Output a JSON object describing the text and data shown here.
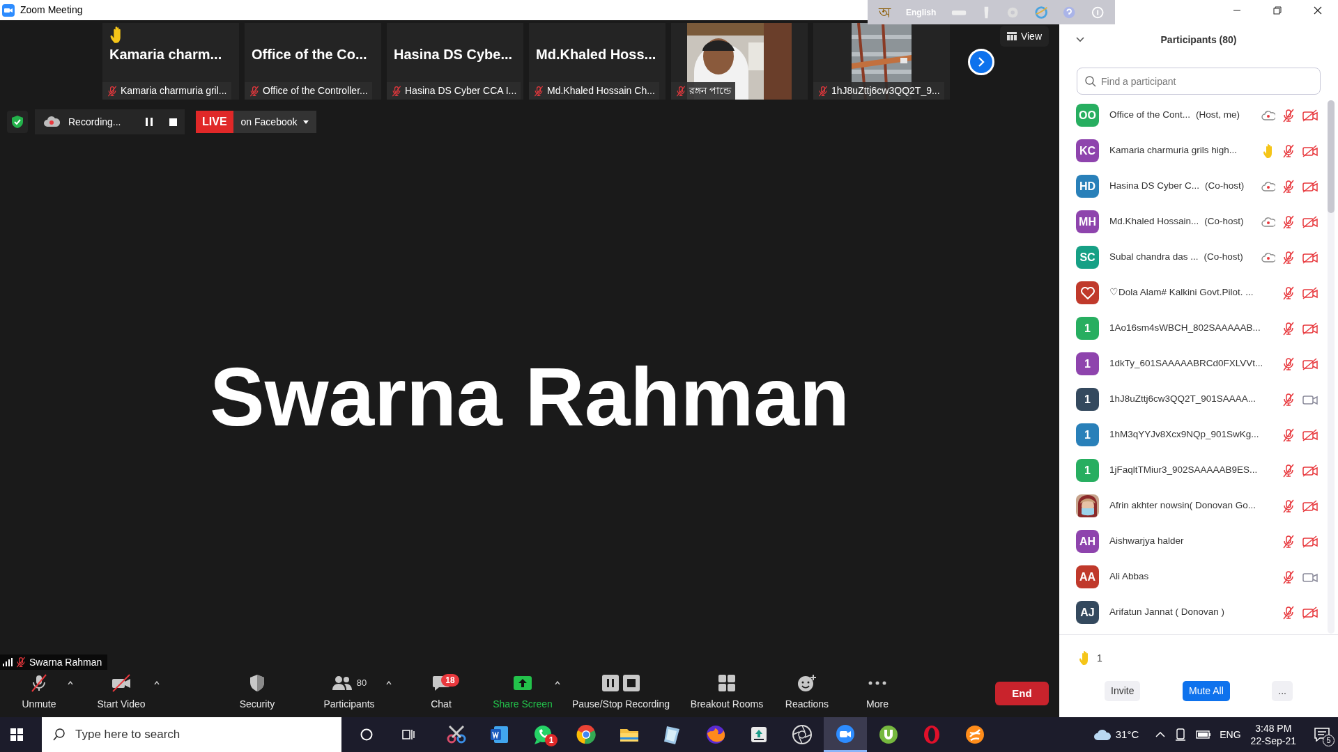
{
  "window": {
    "title": "Zoom Meeting"
  },
  "ime_bar": {
    "script_glyph": "অ",
    "language": "English"
  },
  "thumbnails": [
    {
      "kind": "name",
      "title": "Kamaria charm...",
      "label": "Kamaria charmuria gril...",
      "hand_raised": true
    },
    {
      "kind": "name",
      "title": "Office of the Co...",
      "label": "Office of the Controller...",
      "hand_raised": false
    },
    {
      "kind": "name",
      "title": "Hasina DS Cybe...",
      "label": "Hasina DS Cyber CCA I...",
      "hand_raised": false
    },
    {
      "kind": "name",
      "title": "Md.Khaled Hoss...",
      "label": "Md.Khaled Hossain Ch...",
      "hand_raised": false
    },
    {
      "kind": "video",
      "label": "রঙ্গন পান্ডে",
      "hand_raised": false
    },
    {
      "kind": "video",
      "label": "1hJ8uZttj6cw3QQ2T_9...",
      "hand_raised": false
    }
  ],
  "view_button": "View",
  "recording": {
    "label": "Recording..."
  },
  "live": {
    "badge": "LIVE",
    "target": "on Facebook"
  },
  "speaker": {
    "name": "Swarna Rahman"
  },
  "name_tag": {
    "name": "Swarna Rahman"
  },
  "toolbar": [
    {
      "kind": "mic",
      "label": "Unmute",
      "caret": true
    },
    {
      "kind": "video",
      "label": "Start Video",
      "caret": true
    },
    {
      "kind": "security",
      "label": "Security",
      "caret": false
    },
    {
      "kind": "participants",
      "label": "Participants",
      "count": "80",
      "caret": true
    },
    {
      "kind": "chat",
      "label": "Chat",
      "badge": "18",
      "caret": false
    },
    {
      "kind": "share",
      "label": "Share Screen",
      "caret": true
    },
    {
      "kind": "recording",
      "label": "Pause/Stop Recording",
      "caret": false
    },
    {
      "kind": "breakout",
      "label": "Breakout Rooms",
      "caret": false
    },
    {
      "kind": "reactions",
      "label": "Reactions",
      "caret": false
    },
    {
      "kind": "more",
      "label": "More",
      "caret": false
    }
  ],
  "end_button": "End",
  "participants_panel": {
    "title": "Participants (80)",
    "search_placeholder": "Find a participant",
    "participants": [
      {
        "kind": "initials",
        "initials": "OO",
        "color": "#27ae60",
        "name": "Office of the Cont...",
        "role": "(Host, me)",
        "recording": true,
        "hand_raised": false,
        "muted": true,
        "video_on": false
      },
      {
        "kind": "initials",
        "initials": "KC",
        "color": "#8e44ad",
        "name": "Kamaria charmuria grils high...",
        "recording": false,
        "hand_raised": true,
        "muted": true,
        "video_on": false
      },
      {
        "kind": "initials",
        "initials": "HD",
        "color": "#2980b9",
        "name": "Hasina DS Cyber C...",
        "role": "(Co-host)",
        "recording": true,
        "hand_raised": false,
        "muted": true,
        "video_on": false
      },
      {
        "kind": "initials",
        "initials": "MH",
        "color": "#8e44ad",
        "name": "Md.Khaled Hossain...",
        "role": "(Co-host)",
        "recording": true,
        "hand_raised": false,
        "muted": true,
        "video_on": false
      },
      {
        "kind": "initials",
        "initials": "SC",
        "color": "#16a085",
        "name": "Subal chandra das ...",
        "role": "(Co-host)",
        "recording": true,
        "hand_raised": false,
        "muted": true,
        "video_on": false
      },
      {
        "kind": "heart",
        "color": "#c0392b",
        "name": "♡Dola Alam# Kalkini Govt.Pilot. ...",
        "recording": false,
        "hand_raised": false,
        "muted": true,
        "video_on": false
      },
      {
        "kind": "initials",
        "initials": "1",
        "color": "#27ae60",
        "name": "1Ao16sm4sWBCH_802SAAAAAB...",
        "recording": false,
        "hand_raised": false,
        "muted": true,
        "video_on": false
      },
      {
        "kind": "initials",
        "initials": "1",
        "color": "#8e44ad",
        "name": "1dkTy_601SAAAAABRCd0FXLVVt...",
        "recording": false,
        "hand_raised": false,
        "muted": true,
        "video_on": false
      },
      {
        "kind": "initials",
        "initials": "1",
        "color": "#34495e",
        "name": "1hJ8uZttj6cw3QQ2T_901SAAAA...",
        "recording": false,
        "hand_raised": false,
        "muted": true,
        "video_on": true
      },
      {
        "kind": "initials",
        "initials": "1",
        "color": "#2980b9",
        "name": "1hM3qYYJv8Xcx9NQp_901SwKg...",
        "recording": false,
        "hand_raised": false,
        "muted": true,
        "video_on": false
      },
      {
        "kind": "initials",
        "initials": "1",
        "color": "#27ae60",
        "name": "1jFaqltTMiur3_902SAAAAAB9ES...",
        "recording": false,
        "hand_raised": false,
        "muted": true,
        "video_on": false
      },
      {
        "name": "Afrin akhter nowsin( Donovan Go...",
        "recording": false,
        "hand_raised": false,
        "muted": true,
        "video_on": false
      },
      {
        "kind": "initials",
        "initials": "AH",
        "color": "#8e44ad",
        "name": "Aishwarjya halder",
        "recording": false,
        "hand_raised": false,
        "muted": true,
        "video_on": false
      },
      {
        "kind": "initials",
        "initials": "AA",
        "color": "#c0392b",
        "name": "Ali Abbas",
        "recording": false,
        "hand_raised": false,
        "muted": true,
        "video_on": true
      },
      {
        "kind": "initials",
        "initials": "AJ",
        "color": "#34495e",
        "name": "Arifatun Jannat ( Donovan )",
        "recording": false,
        "hand_raised": false,
        "muted": true,
        "video_on": false
      }
    ],
    "raised_hands": "1",
    "buttons": [
      {
        "kind": "plain",
        "label": "Invite"
      },
      {
        "kind": "primary",
        "label": "Mute All"
      },
      {
        "kind": "plain",
        "label": "..."
      }
    ]
  },
  "taskbar": {
    "search_placeholder": "Type here to search",
    "apps": [
      {
        "kind": "snip",
        "active": false
      },
      {
        "kind": "doc",
        "active": false
      },
      {
        "kind": "chat",
        "active": false,
        "badge": "1"
      },
      {
        "kind": "wheel",
        "active": false
      },
      {
        "kind": "folder",
        "active": false
      },
      {
        "kind": "notebook",
        "active": false
      },
      {
        "kind": "fox",
        "active": false
      },
      {
        "kind": "box",
        "active": false
      },
      {
        "kind": "aperture",
        "active": false
      },
      {
        "kind": "camera",
        "active": true
      },
      {
        "kind": "leaf",
        "active": false
      },
      {
        "kind": "ring",
        "active": false
      },
      {
        "kind": "swirl",
        "active": false
      }
    ],
    "temperature": "31°C",
    "language": "ENG",
    "time": "3:48 PM",
    "date": "22-Sep-21",
    "notifications": "5"
  }
}
